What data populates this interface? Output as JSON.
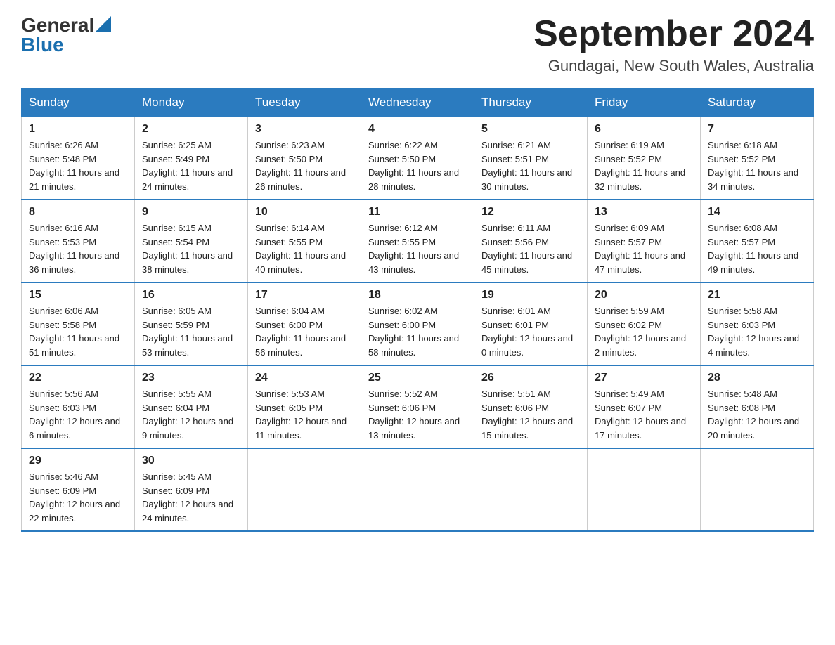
{
  "header": {
    "logo_general": "General",
    "logo_blue": "Blue",
    "month_title": "September 2024",
    "location": "Gundagai, New South Wales, Australia"
  },
  "days_of_week": [
    "Sunday",
    "Monday",
    "Tuesday",
    "Wednesday",
    "Thursday",
    "Friday",
    "Saturday"
  ],
  "weeks": [
    [
      {
        "day": "1",
        "sunrise": "6:26 AM",
        "sunset": "5:48 PM",
        "daylight": "11 hours and 21 minutes."
      },
      {
        "day": "2",
        "sunrise": "6:25 AM",
        "sunset": "5:49 PM",
        "daylight": "11 hours and 24 minutes."
      },
      {
        "day": "3",
        "sunrise": "6:23 AM",
        "sunset": "5:50 PM",
        "daylight": "11 hours and 26 minutes."
      },
      {
        "day": "4",
        "sunrise": "6:22 AM",
        "sunset": "5:50 PM",
        "daylight": "11 hours and 28 minutes."
      },
      {
        "day": "5",
        "sunrise": "6:21 AM",
        "sunset": "5:51 PM",
        "daylight": "11 hours and 30 minutes."
      },
      {
        "day": "6",
        "sunrise": "6:19 AM",
        "sunset": "5:52 PM",
        "daylight": "11 hours and 32 minutes."
      },
      {
        "day": "7",
        "sunrise": "6:18 AM",
        "sunset": "5:52 PM",
        "daylight": "11 hours and 34 minutes."
      }
    ],
    [
      {
        "day": "8",
        "sunrise": "6:16 AM",
        "sunset": "5:53 PM",
        "daylight": "11 hours and 36 minutes."
      },
      {
        "day": "9",
        "sunrise": "6:15 AM",
        "sunset": "5:54 PM",
        "daylight": "11 hours and 38 minutes."
      },
      {
        "day": "10",
        "sunrise": "6:14 AM",
        "sunset": "5:55 PM",
        "daylight": "11 hours and 40 minutes."
      },
      {
        "day": "11",
        "sunrise": "6:12 AM",
        "sunset": "5:55 PM",
        "daylight": "11 hours and 43 minutes."
      },
      {
        "day": "12",
        "sunrise": "6:11 AM",
        "sunset": "5:56 PM",
        "daylight": "11 hours and 45 minutes."
      },
      {
        "day": "13",
        "sunrise": "6:09 AM",
        "sunset": "5:57 PM",
        "daylight": "11 hours and 47 minutes."
      },
      {
        "day": "14",
        "sunrise": "6:08 AM",
        "sunset": "5:57 PM",
        "daylight": "11 hours and 49 minutes."
      }
    ],
    [
      {
        "day": "15",
        "sunrise": "6:06 AM",
        "sunset": "5:58 PM",
        "daylight": "11 hours and 51 minutes."
      },
      {
        "day": "16",
        "sunrise": "6:05 AM",
        "sunset": "5:59 PM",
        "daylight": "11 hours and 53 minutes."
      },
      {
        "day": "17",
        "sunrise": "6:04 AM",
        "sunset": "6:00 PM",
        "daylight": "11 hours and 56 minutes."
      },
      {
        "day": "18",
        "sunrise": "6:02 AM",
        "sunset": "6:00 PM",
        "daylight": "11 hours and 58 minutes."
      },
      {
        "day": "19",
        "sunrise": "6:01 AM",
        "sunset": "6:01 PM",
        "daylight": "12 hours and 0 minutes."
      },
      {
        "day": "20",
        "sunrise": "5:59 AM",
        "sunset": "6:02 PM",
        "daylight": "12 hours and 2 minutes."
      },
      {
        "day": "21",
        "sunrise": "5:58 AM",
        "sunset": "6:03 PM",
        "daylight": "12 hours and 4 minutes."
      }
    ],
    [
      {
        "day": "22",
        "sunrise": "5:56 AM",
        "sunset": "6:03 PM",
        "daylight": "12 hours and 6 minutes."
      },
      {
        "day": "23",
        "sunrise": "5:55 AM",
        "sunset": "6:04 PM",
        "daylight": "12 hours and 9 minutes."
      },
      {
        "day": "24",
        "sunrise": "5:53 AM",
        "sunset": "6:05 PM",
        "daylight": "12 hours and 11 minutes."
      },
      {
        "day": "25",
        "sunrise": "5:52 AM",
        "sunset": "6:06 PM",
        "daylight": "12 hours and 13 minutes."
      },
      {
        "day": "26",
        "sunrise": "5:51 AM",
        "sunset": "6:06 PM",
        "daylight": "12 hours and 15 minutes."
      },
      {
        "day": "27",
        "sunrise": "5:49 AM",
        "sunset": "6:07 PM",
        "daylight": "12 hours and 17 minutes."
      },
      {
        "day": "28",
        "sunrise": "5:48 AM",
        "sunset": "6:08 PM",
        "daylight": "12 hours and 20 minutes."
      }
    ],
    [
      {
        "day": "29",
        "sunrise": "5:46 AM",
        "sunset": "6:09 PM",
        "daylight": "12 hours and 22 minutes."
      },
      {
        "day": "30",
        "sunrise": "5:45 AM",
        "sunset": "6:09 PM",
        "daylight": "12 hours and 24 minutes."
      },
      null,
      null,
      null,
      null,
      null
    ]
  ]
}
